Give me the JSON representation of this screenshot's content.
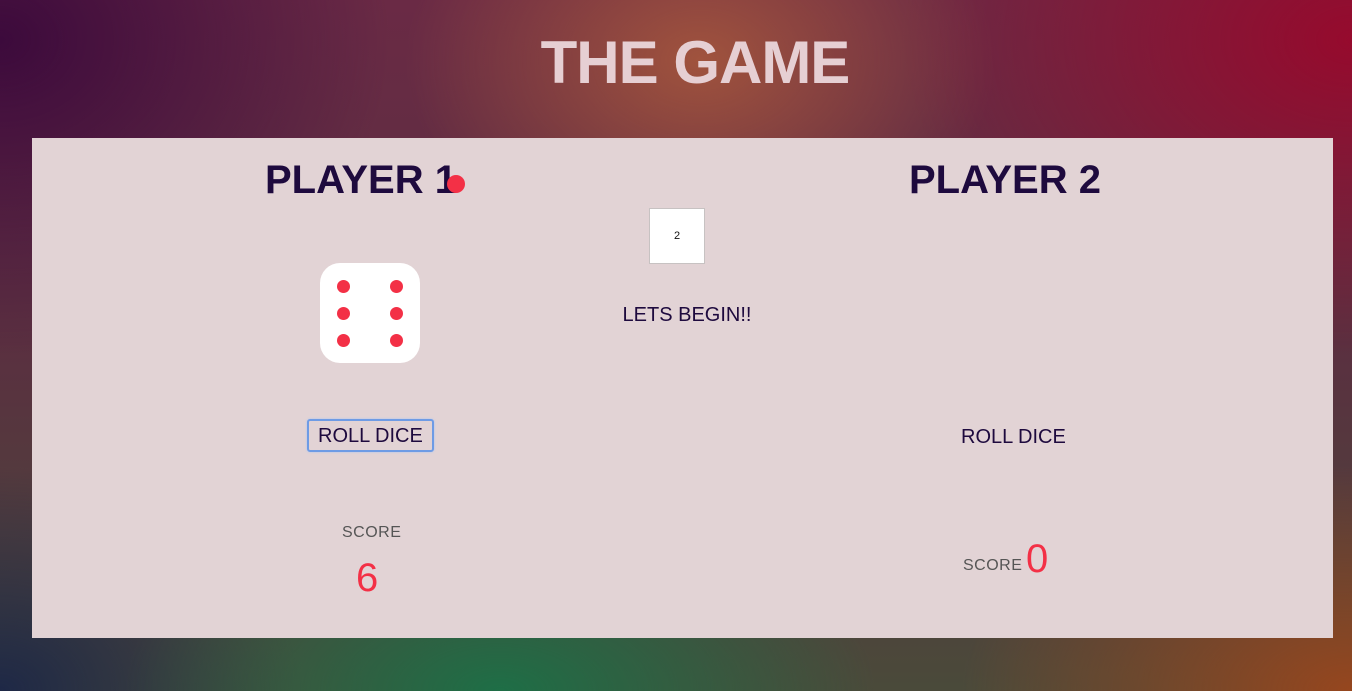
{
  "title": "THE GAME",
  "target_score": {
    "value": "2"
  },
  "message": "LETS BEGIN!!",
  "player1": {
    "name": "PLAYER 1",
    "active": true,
    "dice_value": 6,
    "roll_label": "ROLL DICE",
    "score_label": "SCORE",
    "score": "6"
  },
  "player2": {
    "name": "PLAYER 2",
    "active": false,
    "roll_label": "ROLL DICE",
    "score_label": "SCORE",
    "score": "0"
  },
  "colors": {
    "accent": "#f33046",
    "text": "#1e0a3e",
    "board": "#e2d3d5",
    "focus_ring": "#6e9be5"
  }
}
